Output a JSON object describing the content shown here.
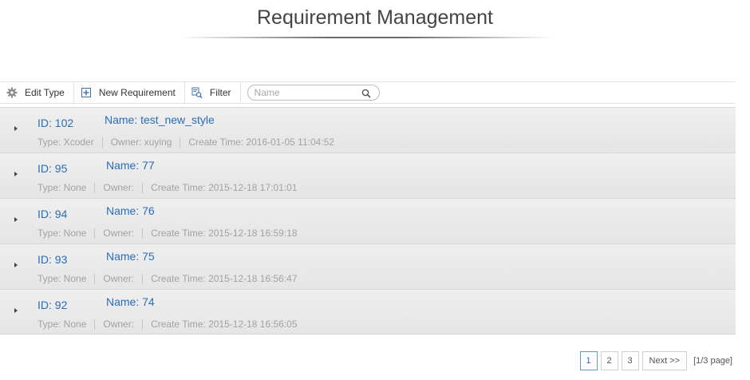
{
  "page": {
    "title": "Requirement Management"
  },
  "toolbar": {
    "edit_type_label": "Edit Type",
    "new_requirement_label": "New Requirement",
    "filter_label": "Filter",
    "search_placeholder": "Name",
    "search_value": ""
  },
  "requirements": [
    {
      "id": "ID: 102",
      "name": "Name: test_new_style",
      "type": "Type: Xcoder",
      "owner": "Owner: xuying",
      "create_time": "Create Time: 2016-01-05 11:04:52"
    },
    {
      "id": "ID: 95",
      "name": "Name: 77",
      "type": "Type: None",
      "owner": "Owner:",
      "create_time": "Create Time: 2015-12-18 17:01:01"
    },
    {
      "id": "ID: 94",
      "name": "Name: 76",
      "type": "Type: None",
      "owner": "Owner:",
      "create_time": "Create Time: 2015-12-18 16:59:18"
    },
    {
      "id": "ID: 93",
      "name": "Name: 75",
      "type": "Type: None",
      "owner": "Owner:",
      "create_time": "Create Time: 2015-12-18 16:56:47"
    },
    {
      "id": "ID: 92",
      "name": "Name: 74",
      "type": "Type: None",
      "owner": "Owner:",
      "create_time": "Create Time: 2015-12-18 16:56:05"
    }
  ],
  "pagination": {
    "pages": [
      "1",
      "2",
      "3"
    ],
    "current": "1",
    "next_label": "Next >>",
    "page_info": "[1/3 page]"
  },
  "icons": {
    "edit_type": "gear-icon",
    "new_requirement": "plus-box-icon",
    "filter": "filter-icon",
    "search": "search-icon",
    "row_toggle": "caret-right-icon"
  },
  "colors": {
    "link": "#2a6db6",
    "meta_text": "#a2a2a2",
    "row_bg": "#e9e9e9",
    "pager_active_border": "#5b9bd5"
  }
}
